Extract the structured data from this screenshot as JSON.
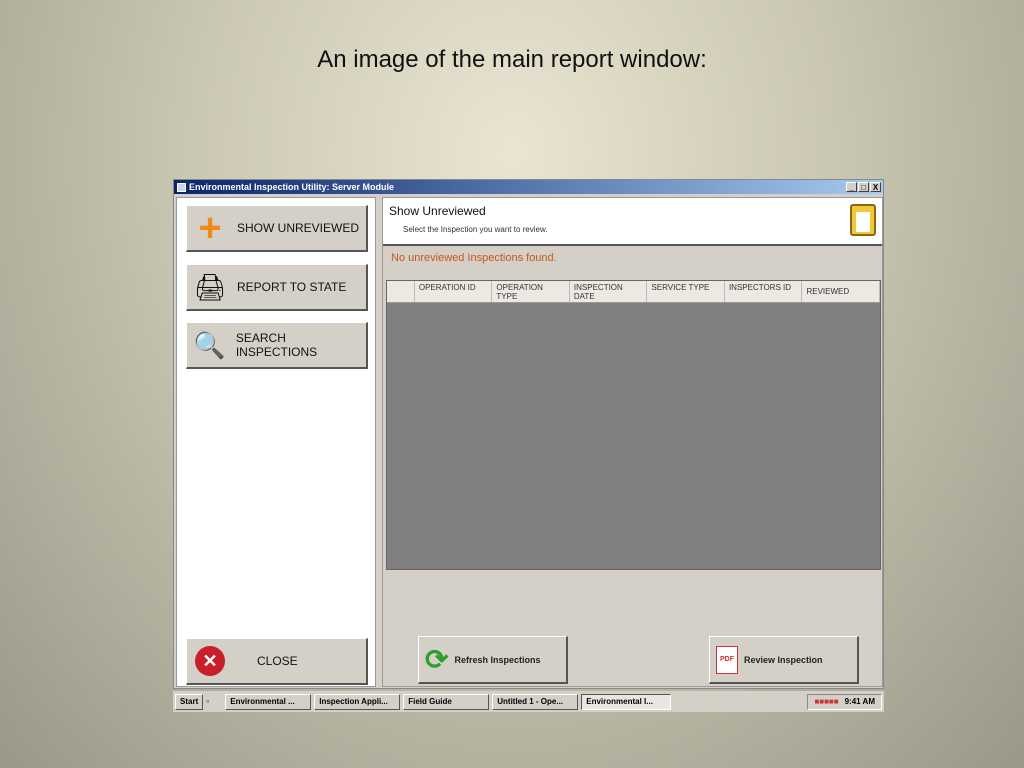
{
  "caption": "An image of the main report window:",
  "window": {
    "title": "Environmental Inspection Utility: Server Module",
    "controls": [
      "_",
      "□",
      "X"
    ]
  },
  "sidebar": {
    "show_unreviewed": "SHOW UNREVIEWED",
    "report_to_state": "REPORT TO STATE",
    "search_inspections": "SEARCH INSPECTIONS",
    "close": "CLOSE"
  },
  "panel": {
    "title": "Show Unreviewed",
    "subtitle": "Select the Inspection you want to review.",
    "message": "No unreviewed Inspections found."
  },
  "grid": {
    "columns": [
      "",
      "OPERATION ID",
      "OPERATION TYPE",
      "INSPECTION DATE",
      "SERVICE TYPE",
      "INSPECTORS ID",
      "REVIEWED"
    ]
  },
  "buttons": {
    "refresh": "Refresh Inspections",
    "review": "Review Inspection"
  },
  "taskbar": {
    "start": "Start",
    "items": [
      "Environmental ...",
      "Inspection Appli...",
      "Field Guide",
      "Untitled 1 - Ope...",
      "Environmental I..."
    ],
    "clock": "9:41 AM"
  }
}
